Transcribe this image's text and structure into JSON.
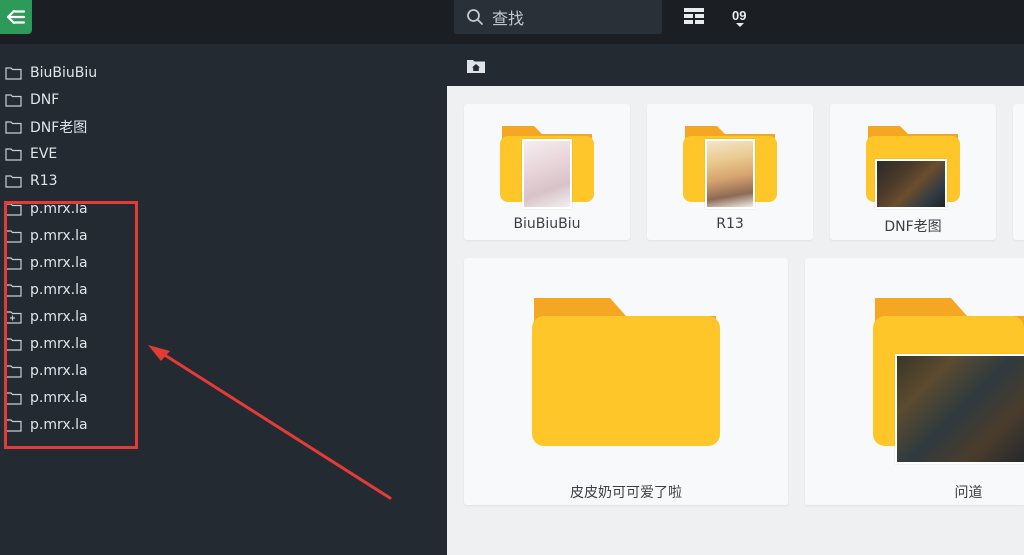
{
  "header": {
    "menu_icon": "menu-collapse-icon",
    "search_placeholder": "查找",
    "layout_icon": "grid-layout-icon",
    "sort_label": "09"
  },
  "sidebar": {
    "items": [
      {
        "label": "BiuBiuBiu",
        "icon": "folder-icon"
      },
      {
        "label": "DNF",
        "icon": "folder-icon"
      },
      {
        "label": "DNF老图",
        "icon": "folder-icon"
      },
      {
        "label": "EVE",
        "icon": "folder-icon"
      },
      {
        "label": "R13",
        "icon": "folder-icon"
      },
      {
        "label": "p.mrx.la",
        "icon": "folder-icon"
      },
      {
        "label": "p.mrx.la",
        "icon": "folder-icon"
      },
      {
        "label": "p.mrx.la",
        "icon": "folder-icon"
      },
      {
        "label": "p.mrx.la",
        "icon": "folder-icon"
      },
      {
        "label": "p.mrx.la",
        "icon": "folder-plus-icon"
      },
      {
        "label": "p.mrx.la",
        "icon": "folder-icon"
      },
      {
        "label": "p.mrx.la",
        "icon": "folder-icon"
      },
      {
        "label": "p.mrx.la",
        "icon": "folder-icon"
      },
      {
        "label": "p.mrx.la",
        "icon": "folder-icon"
      }
    ]
  },
  "breadcrumb": {
    "icon": "home-folder-icon"
  },
  "folders": [
    {
      "name": "BiuBiuBiu",
      "thumb": "anime-girl"
    },
    {
      "name": "R13",
      "thumb": "blonde-girl"
    },
    {
      "name": "DNF老图",
      "thumb": "game-screenshot"
    },
    {
      "name": "皮皮奶可可爱了啦",
      "thumb": "none"
    },
    {
      "name": "问道",
      "thumb": "game-inventory"
    }
  ],
  "colors": {
    "accent": "#2e9a59",
    "folder_back": "#f5a623",
    "folder_front": "#ffc629",
    "highlight": "#e33b35"
  }
}
